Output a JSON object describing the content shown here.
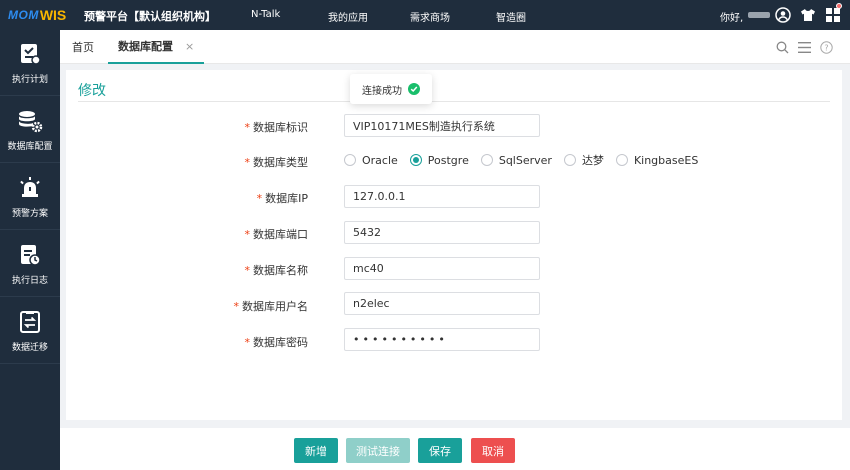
{
  "header": {
    "logo_text": "MOM",
    "logo_suffix": "WIS",
    "platform": "预警平台【默认组织机构】",
    "nav": [
      "N-Talk",
      "我的应用",
      "需求商场",
      "智造圈"
    ],
    "greeting": "你好,",
    "icons": [
      "user-circle-icon",
      "tshirt-icon",
      "grid-icon"
    ]
  },
  "sidebar": {
    "items": [
      {
        "label": "执行计划",
        "icon": "plan-check-icon"
      },
      {
        "label": "数据库配置",
        "icon": "database-gear-icon"
      },
      {
        "label": "预警方案",
        "icon": "alarm-icon"
      },
      {
        "label": "执行日志",
        "icon": "log-clock-icon"
      },
      {
        "label": "数据迁移",
        "icon": "migrate-icon"
      }
    ]
  },
  "tabs": {
    "home": "首页",
    "active": "数据库配置",
    "close": "×",
    "tools": [
      "search-icon",
      "menu-icon",
      "help-icon"
    ]
  },
  "form": {
    "title": "修改",
    "toast": "连接成功",
    "required_mark": "*",
    "fields": {
      "db_id": {
        "label": "数据库标识",
        "value": "VIP10171MES制造执行系统"
      },
      "db_type": {
        "label": "数据库类型",
        "options": [
          "Oracle",
          "Postgre",
          "SqlServer",
          "达梦",
          "KingbaseES"
        ],
        "selected": "Postgre"
      },
      "db_ip": {
        "label": "数据库IP",
        "value": "127.0.0.1"
      },
      "db_port": {
        "label": "数据库端口",
        "value": "5432"
      },
      "db_name": {
        "label": "数据库名称",
        "value": "mc40"
      },
      "db_user": {
        "label": "数据库用户名",
        "value": "n2elec"
      },
      "db_password": {
        "label": "数据库密码",
        "value": "••••••••••"
      }
    }
  },
  "actions": {
    "add": "新增",
    "test": "测试连接",
    "save": "保存",
    "cancel": "取消"
  },
  "colors": {
    "primary": "#19a09a",
    "danger": "#ed4f4f",
    "nav_bg": "#1f2d3d",
    "success": "#19be6b"
  }
}
